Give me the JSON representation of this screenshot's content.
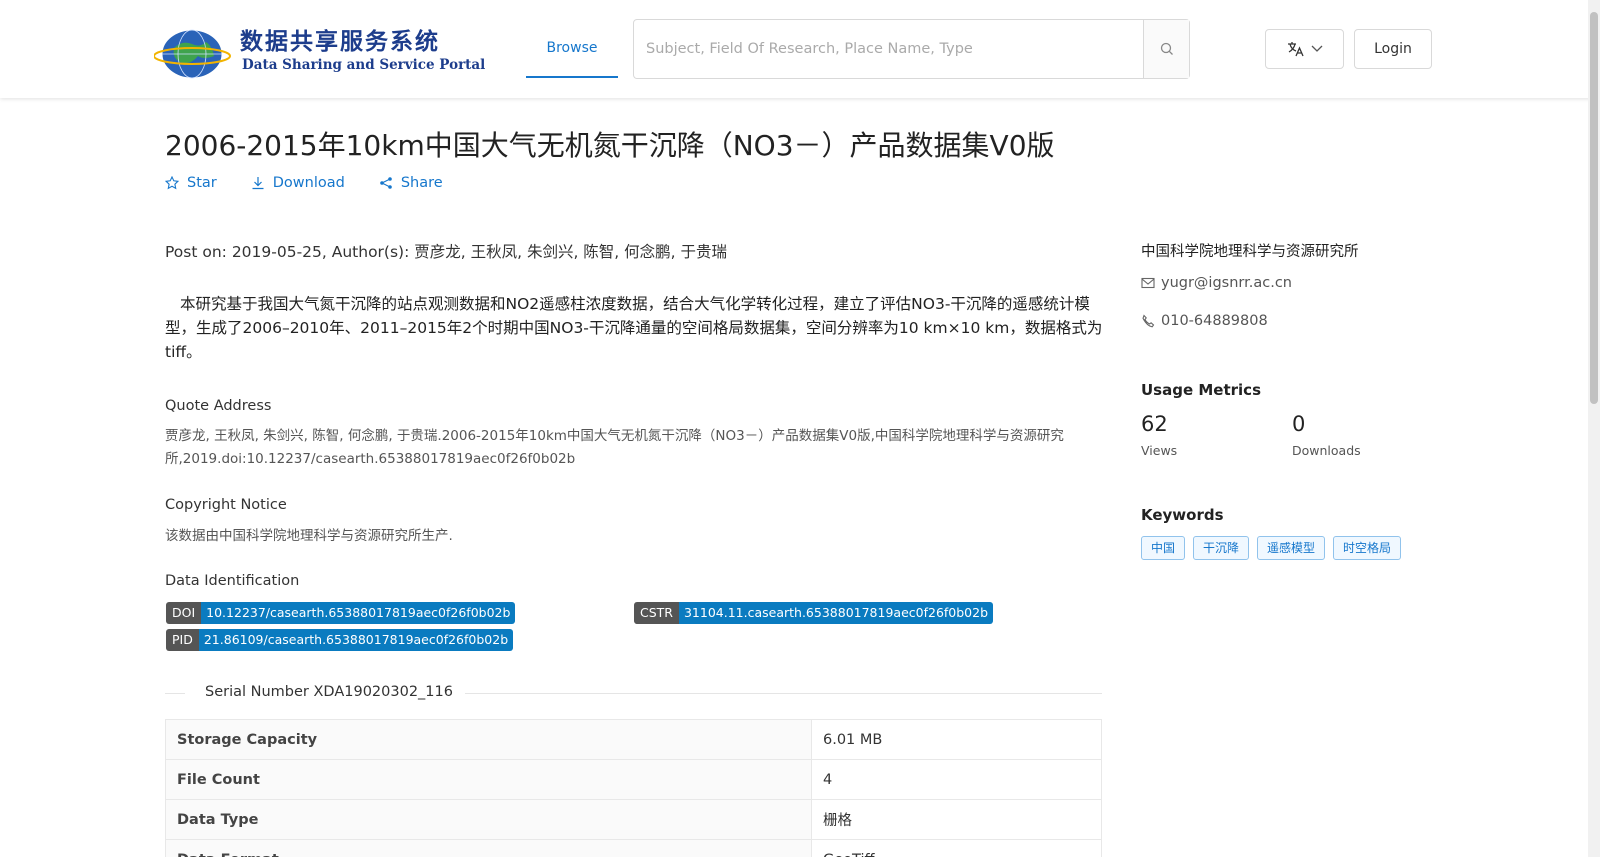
{
  "header": {
    "logo_cn": "数据共享服务系统",
    "logo_en": "Data Sharing and Service Portal",
    "nav_browse": "Browse",
    "search_placeholder": "Subject, Field Of Research, Place Name, Type",
    "login": "Login"
  },
  "dataset": {
    "title": "2006-2015年10km中国大气无机氮干沉降（NO3－）产品数据集V0版",
    "actions": {
      "star": "Star",
      "download": "Download",
      "share": "Share"
    },
    "meta": "Post on: 2019-05-25, Author(s): 贾彦龙, 王秋凤, 朱剑兴, 陈智, 何念鹏, 于贵瑞",
    "abstract": "本研究基于我国大气氮干沉降的站点观测数据和NO2遥感柱浓度数据，结合大气化学转化过程，建立了评估NO3-干沉降的遥感统计模型，生成了2006–2010年、2011–2015年2个时期中国NO3-干沉降通量的空间格局数据集，空间分辨率为10 km×10 km，数据格式为tiff。",
    "quote_label": "Quote Address",
    "quote_text": "贾彦龙, 王秋凤, 朱剑兴, 陈智, 何念鹏, 于贵瑞.2006-2015年10km中国大气无机氮干沉降（NO3－）产品数据集V0版,中国科学院地理科学与资源研究所,2019.doi:10.12237/casearth.65388017819aec0f26f0b02b",
    "copyright_label": "Copyright Notice",
    "copyright_text": "该数据由中国科学院地理科学与资源研究所生产.",
    "ident_label": "Data Identification",
    "identifiers": {
      "doi_key": "DOI",
      "doi_val": "10.12237/casearth.65388017819aec0f26f0b02b",
      "cstr_key": "CSTR",
      "cstr_val": "31104.11.casearth.65388017819aec0f26f0b02b",
      "pid_key": "PID",
      "pid_val": "21.86109/casearth.65388017819aec0f26f0b02b"
    },
    "serial": "Serial Number XDA19020302_116",
    "properties": [
      {
        "key": "Storage Capacity",
        "value": "6.01 MB"
      },
      {
        "key": "File Count",
        "value": "4"
      },
      {
        "key": "Data Type",
        "value": "栅格"
      },
      {
        "key": "Data Format",
        "value": "GeoTiff"
      }
    ]
  },
  "sidebar": {
    "org": "中国科学院地理科学与资源研究所",
    "email": "yugr@igsnrr.ac.cn",
    "phone": "010-64889808",
    "metrics_title": "Usage Metrics",
    "views_num": "62",
    "views_label": "Views",
    "downloads_num": "0",
    "downloads_label": "Downloads",
    "keywords_title": "Keywords",
    "keywords": [
      "中国",
      "干沉降",
      "遥感模型",
      "时空格局"
    ]
  }
}
